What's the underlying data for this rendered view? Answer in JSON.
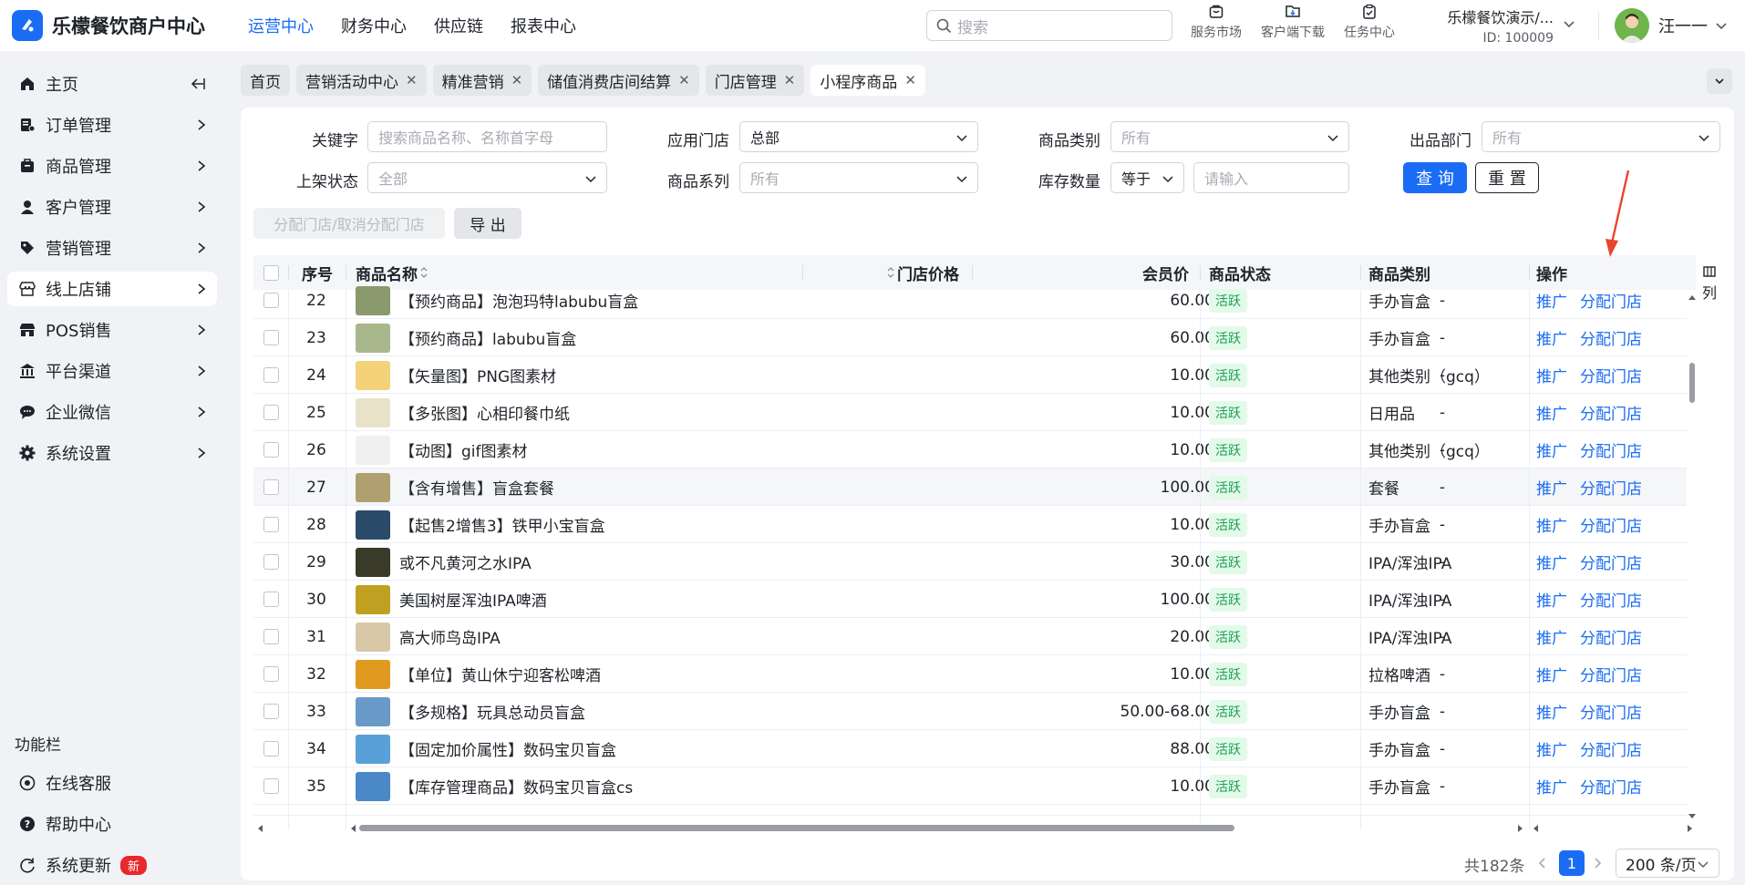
{
  "app": {
    "brand_name": "乐檬餐饮商户中心"
  },
  "top_nav": [
    "运营中心",
    "财务中心",
    "供应链",
    "报表中心"
  ],
  "search": {
    "placeholder": "搜索"
  },
  "tools": [
    {
      "label": "服务市场",
      "icon": "store-icon"
    },
    {
      "label": "客户端下载",
      "icon": "download-icon"
    },
    {
      "label": "任务中心",
      "icon": "task-icon"
    }
  ],
  "tenant": {
    "name": "乐檬餐饮演示/...",
    "id": "ID: 100009"
  },
  "user": {
    "name": "汪一一"
  },
  "sidebar": {
    "items": [
      {
        "label": "主页",
        "icon": "home-icon"
      },
      {
        "label": "订单管理",
        "icon": "order-icon"
      },
      {
        "label": "商品管理",
        "icon": "product-icon"
      },
      {
        "label": "客户管理",
        "icon": "user-icon"
      },
      {
        "label": "营销管理",
        "icon": "tag-icon"
      },
      {
        "label": "线上店铺",
        "icon": "shop-icon"
      },
      {
        "label": "POS销售",
        "icon": "pos-icon"
      },
      {
        "label": "平台渠道",
        "icon": "bank-icon"
      },
      {
        "label": "企业微信",
        "icon": "chat-icon"
      },
      {
        "label": "系统设置",
        "icon": "gear-icon"
      }
    ],
    "section_title": "功能栏",
    "footer": [
      {
        "label": "在线客服",
        "icon": "support-icon"
      },
      {
        "label": "帮助中心",
        "icon": "help-icon"
      },
      {
        "label": "系统更新",
        "icon": "refresh-icon",
        "badge": "新"
      }
    ]
  },
  "tabs": [
    {
      "label": "首页",
      "closable": false
    },
    {
      "label": "营销活动中心",
      "closable": true
    },
    {
      "label": "精准营销",
      "closable": true
    },
    {
      "label": "储值消费店间结算",
      "closable": true
    },
    {
      "label": "门店管理",
      "closable": true
    },
    {
      "label": "小程序商品",
      "closable": true,
      "active": true
    }
  ],
  "filters": {
    "keyword": {
      "label": "关键字",
      "placeholder": "搜索商品名称、名称首字母"
    },
    "store": {
      "label": "应用门店",
      "value": "总部"
    },
    "category": {
      "label": "商品类别",
      "placeholder": "所有"
    },
    "dept": {
      "label": "出品部门",
      "placeholder": "所有"
    },
    "shelf": {
      "label": "上架状态",
      "placeholder": "全部"
    },
    "series": {
      "label": "商品系列",
      "placeholder": "所有"
    },
    "stock": {
      "label": "库存数量",
      "op": "等于",
      "placeholder": "请输入"
    },
    "query_btn": "查 询",
    "reset_btn": "重 置"
  },
  "actions": {
    "assign_btn": "分配门店/取消分配门店",
    "export_btn": "导 出"
  },
  "table": {
    "headers": {
      "seq": "序号",
      "name": "商品名称",
      "price": "门店价格",
      "member": "会员价",
      "status": "商品状态",
      "category": "商品类别",
      "ops": "操作"
    },
    "column_toggle": "列",
    "op_labels": {
      "promote": "推广",
      "assign": "分配门店"
    },
    "rows": [
      {
        "seq": "22",
        "name": "【预约商品】泡泡玛特labubu盲盒",
        "price": "60.00",
        "member": "-",
        "status": "活跃",
        "category": "手办盲盒",
        "thumb": "#8a9a6c"
      },
      {
        "seq": "23",
        "name": "【预约商品】labubu盲盒",
        "price": "60.00",
        "member": "-",
        "status": "活跃",
        "category": "手办盲盒",
        "thumb": "#a8b88c"
      },
      {
        "seq": "24",
        "name": "【矢量图】PNG图素材",
        "price": "10.00",
        "member": "-",
        "status": "活跃",
        "category": "其他类别（gcq）",
        "thumb": "#f3d27a"
      },
      {
        "seq": "25",
        "name": "【多张图】心相印餐巾纸",
        "price": "10.00",
        "member": "-",
        "status": "活跃",
        "category": "日用品",
        "thumb": "#e8e2c8"
      },
      {
        "seq": "26",
        "name": "【动图】gif图素材",
        "price": "10.00",
        "member": "-",
        "status": "活跃",
        "category": "其他类别（gcq）",
        "thumb": "#f0f0f0"
      },
      {
        "seq": "27",
        "name": "【含有增售】盲盒套餐",
        "price": "100.00",
        "member": "-",
        "status": "活跃",
        "category": "套餐",
        "thumb": "#b0a070"
      },
      {
        "seq": "28",
        "name": "【起售2增售3】铁甲小宝盲盒",
        "price": "10.00",
        "member": "-",
        "status": "活跃",
        "category": "手办盲盒",
        "thumb": "#2a4a6a"
      },
      {
        "seq": "29",
        "name": "或不凡黄河之水IPA",
        "price": "30.00",
        "member": "-",
        "status": "活跃",
        "category": "IPA/浑浊IPA",
        "thumb": "#3a3a2a"
      },
      {
        "seq": "30",
        "name": "美国树屋浑浊IPA啤酒",
        "price": "100.00",
        "member": "-",
        "status": "活跃",
        "category": "IPA/浑浊IPA",
        "thumb": "#c0a020"
      },
      {
        "seq": "31",
        "name": "高大师鸟岛IPA",
        "price": "20.00",
        "member": "-",
        "status": "活跃",
        "category": "IPA/浑浊IPA",
        "thumb": "#d8c8a8"
      },
      {
        "seq": "32",
        "name": "【单位】黄山休宁迎客松啤酒",
        "price": "10.00",
        "member": "-",
        "status": "活跃",
        "category": "拉格啤酒",
        "thumb": "#e09a20"
      },
      {
        "seq": "33",
        "name": "【多规格】玩具总动员盲盒",
        "price": "50.00-68.00",
        "member": "-",
        "status": "活跃",
        "category": "手办盲盒",
        "thumb": "#6a9ac8"
      },
      {
        "seq": "34",
        "name": "【固定加价属性】数码宝贝盲盒",
        "price": "88.00",
        "member": "-",
        "status": "活跃",
        "category": "手办盲盒",
        "thumb": "#5aa0d8"
      },
      {
        "seq": "35",
        "name": "【库存管理商品】数码宝贝盲盒cs",
        "price": "10.00",
        "member": "-",
        "status": "活跃",
        "category": "手办盲盒",
        "thumb": "#4a88c8"
      }
    ]
  },
  "pagination": {
    "total": "共182条",
    "current": "1",
    "page_size": "200 条/页"
  },
  "colors": {
    "primary": "#1a6cf5",
    "status_bg": "#e3f9e9",
    "status_fg": "#1aa053",
    "badge": "#e8282a",
    "annotation_arrow": "#e8452c"
  }
}
